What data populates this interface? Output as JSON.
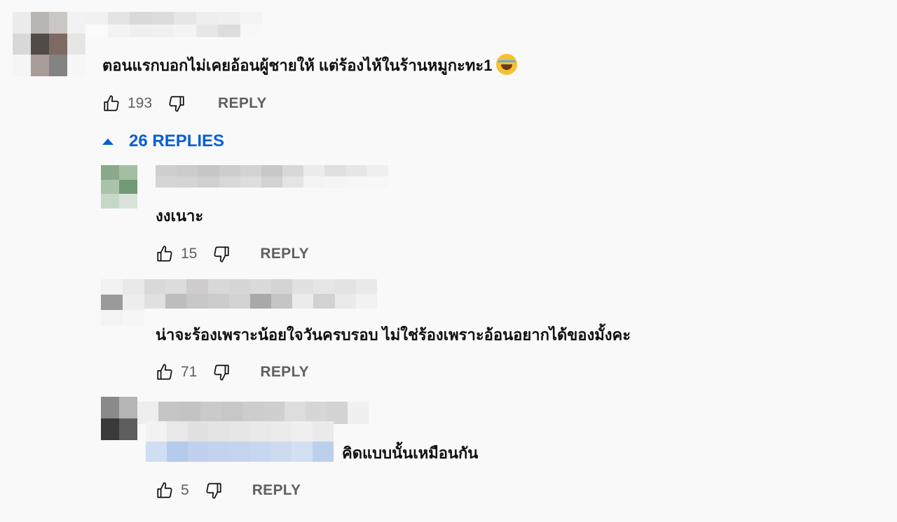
{
  "top_comment": {
    "text": "ตอนแรกบอกไม่เคยอ้อนผู้ชายให้ แต่ร้องไห้ในร้านหมูกะทะ1",
    "emoji": "face-with-tears-of-joy-icon",
    "likes": "193",
    "reply_label": "REPLY"
  },
  "replies_toggle": {
    "label": "26 REPLIES",
    "icon": "caret-up-icon",
    "color": "#065fd4"
  },
  "replies": [
    {
      "text": "งงเนาะ",
      "likes": "15",
      "reply_label": "REPLY"
    },
    {
      "text": "น่าจะร้องเพราะน้อยใจวันครบรอบ ไม่ใช่ร้องเพราะอ้อนอยากได้ของมั้งคะ",
      "likes": "71",
      "reply_label": "REPLY"
    },
    {
      "text": "คิดแบบนั้นเหมือนกัน",
      "likes": "5",
      "reply_label": "REPLY"
    }
  ],
  "icons": {
    "like": "thumbs-up-icon",
    "dislike": "thumbs-down-icon"
  }
}
